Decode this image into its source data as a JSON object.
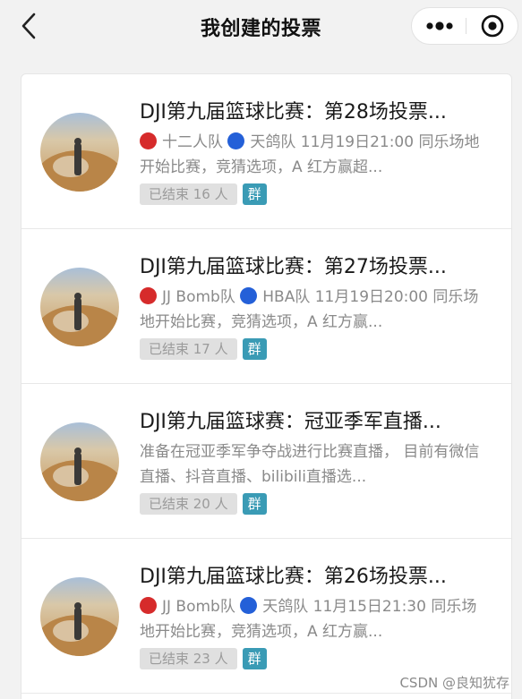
{
  "header": {
    "title": "我创建的投票",
    "more_icon": "more-dots-icon",
    "close_icon": "target-circle-icon"
  },
  "colors": {
    "red_team": "#d62b2b",
    "blue_team": "#2460d8",
    "group_badge": "#3a9bb5",
    "status_badge": "#e0e0e0"
  },
  "items": [
    {
      "title": "DJI第九届篮球比赛：第28场投票...",
      "desc_a": "十二人队",
      "desc_b": "天鸽队 11月19日21:00 同乐场地开始比赛，竞猜选项，A 红方赢超...",
      "status": "已结束 16 人",
      "group": "群"
    },
    {
      "title": "DJI第九届篮球比赛：第27场投票...",
      "desc_a": "JJ Bomb队",
      "desc_b": "HBA队 11月19日20:00 同乐场地开始比赛，竞猜选项，A 红方赢...",
      "status": "已结束 17 人",
      "group": "群"
    },
    {
      "title": "DJI第九届篮球赛：冠亚季军直播...",
      "desc_text": "准备在冠亚季军争夺战进行比赛直播， 目前有微信直播、抖音直播、bilibili直播选...",
      "status": "已结束 20 人",
      "group": "群"
    },
    {
      "title": "DJI第九届篮球比赛：第26场投票...",
      "desc_a": "JJ Bomb队",
      "desc_b": "天鸽队 11月15日21:30 同乐场地开始比赛，竞猜选项，A 红方赢...",
      "status": "已结束 23 人",
      "group": "群"
    }
  ],
  "watermark": "CSDN @良知犹存"
}
